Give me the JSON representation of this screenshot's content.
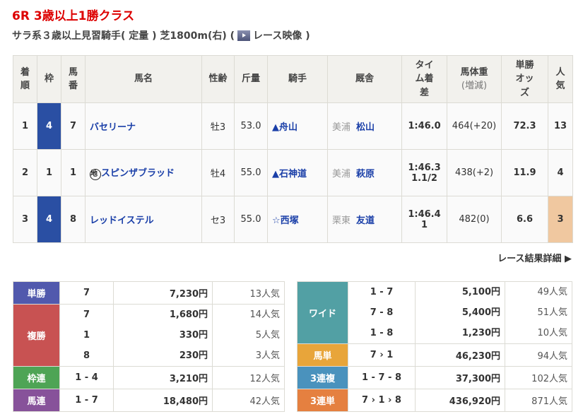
{
  "race": {
    "title": "6R 3歳以上1勝クラス",
    "conditions": "サラ系３歳以上見習騎手( 定量 ) 芝1800m(右)  (",
    "video_label": "レース映像 )"
  },
  "headers": {
    "rank": "着順",
    "waku": "枠",
    "num": "馬番",
    "name": "馬名",
    "sexage": "性齢",
    "weight": "斤量",
    "jockey": "騎手",
    "stable": "厩舎",
    "time": "タイム着差",
    "body": "馬体重",
    "body_sub": "(増減)",
    "odds": "単勝オッズ",
    "pop": "人気"
  },
  "rows": [
    {
      "rank": "1",
      "waku": "4",
      "num": "7",
      "mark": "",
      "name": "バセリーナ",
      "sexage": "牡3",
      "weight": "53.0",
      "jockey": "▲舟山",
      "stable_area": "美浦",
      "stable": "松山",
      "time": "1:46.0",
      "margin": "",
      "body": "464(+20)",
      "odds": "72.3",
      "pop": "13"
    },
    {
      "rank": "2",
      "waku": "1",
      "num": "1",
      "mark": "地",
      "name": "スピンザブラッド",
      "sexage": "牡4",
      "weight": "55.0",
      "jockey": "▲石神道",
      "stable_area": "美浦",
      "stable": "萩原",
      "time": "1:46.3",
      "margin": "1.1/2",
      "body": "438(+2)",
      "odds": "11.9",
      "pop": "4"
    },
    {
      "rank": "3",
      "waku": "4",
      "num": "8",
      "mark": "",
      "name": "レッドイステル",
      "sexage": "セ3",
      "weight": "55.0",
      "jockey": "☆西塚",
      "stable_area": "栗東",
      "stable": "友道",
      "time": "1:46.4",
      "margin": "1",
      "body": "482(0)",
      "odds": "6.6",
      "pop": "3"
    }
  ],
  "more_link": "レース結果詳細 ▶",
  "payouts_left": [
    {
      "label": "単勝",
      "color": "#5159ad",
      "items": [
        {
          "c": "7",
          "a": "7,230円",
          "p": "13人気"
        }
      ]
    },
    {
      "label": "複勝",
      "color": "#c85252",
      "items": [
        {
          "c": "7",
          "a": "1,680円",
          "p": "14人気"
        },
        {
          "c": "1",
          "a": "330円",
          "p": "5人気"
        },
        {
          "c": "8",
          "a": "230円",
          "p": "3人気"
        }
      ]
    },
    {
      "label": "枠連",
      "color": "#4ea455",
      "items": [
        {
          "c": "1 - 4",
          "a": "3,210円",
          "p": "12人気"
        }
      ]
    },
    {
      "label": "馬連",
      "color": "#87529a",
      "items": [
        {
          "c": "1 - 7",
          "a": "18,480円",
          "p": "42人気"
        }
      ]
    }
  ],
  "payouts_right": [
    {
      "label": "ワイド",
      "color": "#52a0a4",
      "items": [
        {
          "c": "1 - 7",
          "a": "5,100円",
          "p": "49人気"
        },
        {
          "c": "7 - 8",
          "a": "5,400円",
          "p": "51人気"
        },
        {
          "c": "1 - 8",
          "a": "1,230円",
          "p": "10人気"
        }
      ]
    },
    {
      "label": "馬単",
      "color": "#e8a53a",
      "items": [
        {
          "c": "7 › 1",
          "a": "46,230円",
          "p": "94人気"
        }
      ]
    },
    {
      "label": "3連複",
      "color": "#4a92bd",
      "items": [
        {
          "c": "1 - 7 - 8",
          "a": "37,300円",
          "p": "102人気"
        }
      ]
    },
    {
      "label": "3連単",
      "color": "#e58040",
      "items": [
        {
          "c": "7 › 1 › 8",
          "a": "436,920円",
          "p": "871人気"
        }
      ]
    }
  ]
}
